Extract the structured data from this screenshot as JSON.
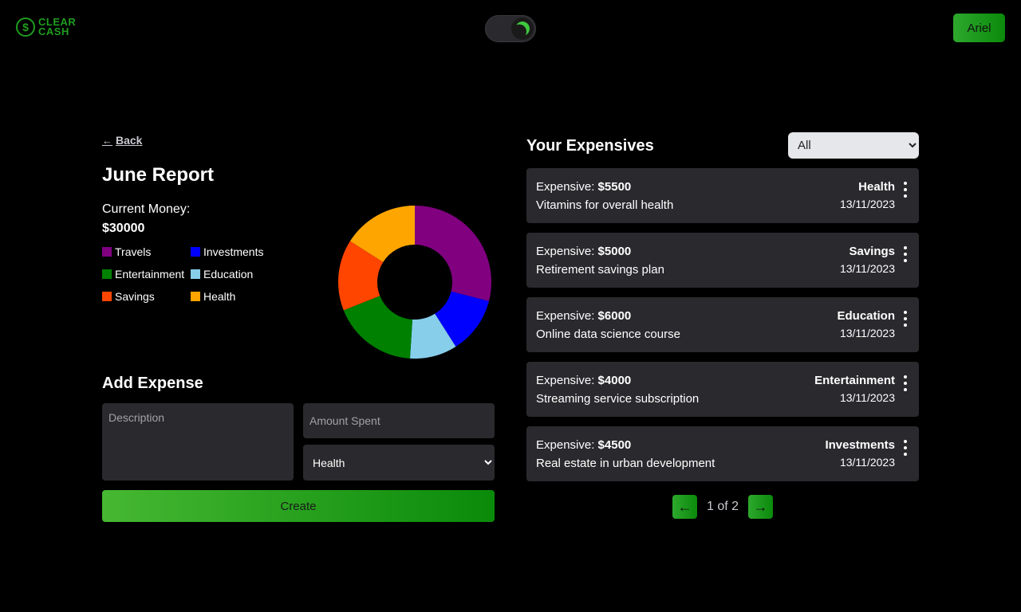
{
  "header": {
    "logo_line1": "CLEAR",
    "logo_line2": "CASH",
    "logo_symbol": "$",
    "theme_icon": "moon-icon",
    "user_name": "Ariel"
  },
  "report": {
    "back_label": "Back",
    "title": "June Report",
    "money_label": "Current Money:",
    "money_value": "$30000"
  },
  "chart_data": {
    "type": "pie",
    "categories": [
      "Travels",
      "Investments",
      "Education",
      "Entertainment",
      "Savings",
      "Health"
    ],
    "colors": [
      "#800080",
      "#0000ff",
      "#87ceeb",
      "#008000",
      "#ff4500",
      "#ffa500"
    ],
    "values": [
      29,
      12,
      10,
      18,
      15,
      16
    ],
    "legend_order": [
      "Travels",
      "Investments",
      "Entertainment",
      "Education",
      "Savings",
      "Health"
    ]
  },
  "legend": [
    {
      "label": "Travels",
      "color": "#800080"
    },
    {
      "label": "Investments",
      "color": "#0000ff"
    },
    {
      "label": "Entertainment",
      "color": "#008000"
    },
    {
      "label": "Education",
      "color": "#87ceeb"
    },
    {
      "label": "Savings",
      "color": "#ff4500"
    },
    {
      "label": "Health",
      "color": "#ffa500"
    }
  ],
  "add_expense": {
    "title": "Add Expense",
    "description_placeholder": "Description",
    "amount_placeholder": "Amount Spent",
    "category_selected": "Health",
    "create_label": "Create"
  },
  "expenses": {
    "title": "Your Expensives",
    "filter_selected": "All",
    "items": [
      {
        "prefix": "Expensive:",
        "amount": "$5500",
        "description": "Vitamins for overall health",
        "category": "Health",
        "date": "13/11/2023"
      },
      {
        "prefix": "Expensive:",
        "amount": "$5000",
        "description": "Retirement savings plan",
        "category": "Savings",
        "date": "13/11/2023"
      },
      {
        "prefix": "Expensive:",
        "amount": "$6000",
        "description": "Online data science course",
        "category": "Education",
        "date": "13/11/2023"
      },
      {
        "prefix": "Expensive:",
        "amount": "$4000",
        "description": "Streaming service subscription",
        "category": "Entertainment",
        "date": "13/11/2023"
      },
      {
        "prefix": "Expensive:",
        "amount": "$4500",
        "description": "Real estate in urban development",
        "category": "Investments",
        "date": "13/11/2023"
      }
    ],
    "pagination": "1 of 2"
  },
  "colors": {
    "background": "#000000",
    "card": "#2a2a2e",
    "accent": "#1f9d1f"
  }
}
